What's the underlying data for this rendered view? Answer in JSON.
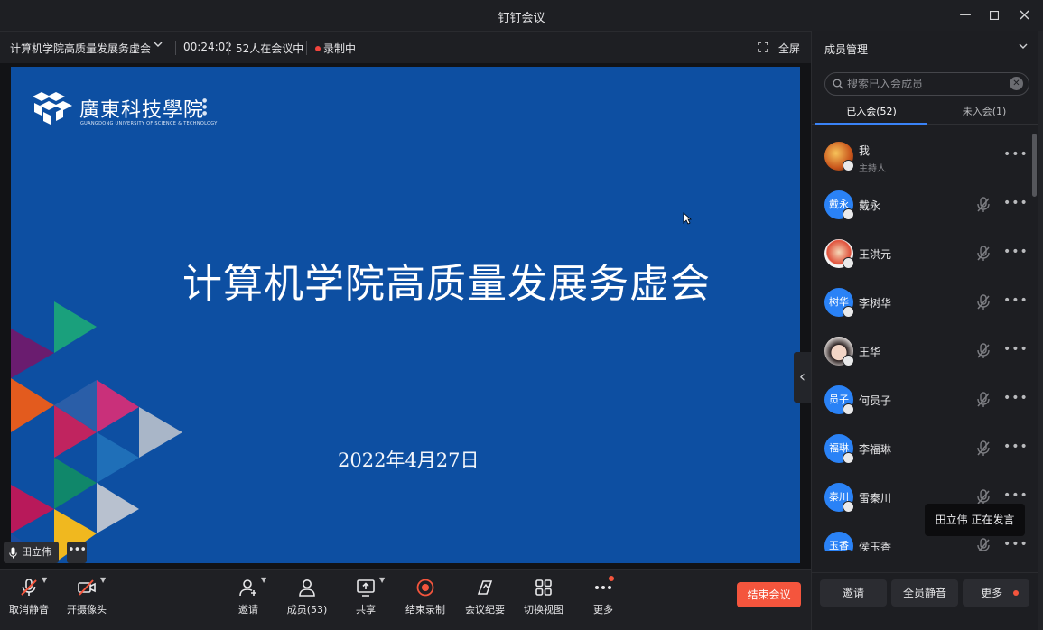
{
  "window": {
    "title": "钉钉会议"
  },
  "infobar": {
    "meeting_title": "计算机学院高质量发展务虚会",
    "duration": "00:24:02",
    "participants": "52人在会议中",
    "recording": "录制中",
    "fullscreen": "全屏"
  },
  "slide": {
    "school_name": "廣東科技學院",
    "school_name_en": "GUANGDONG UNIVERSITY OF SCIENCE & TECHNOLOGY",
    "title": "计算机学院高质量发展务虚会",
    "date": "2022年4月27日"
  },
  "speaker": {
    "name": "田立伟"
  },
  "toolbar": {
    "unmute": "取消静音",
    "camera": "开摄像头",
    "invite": "邀请",
    "members": "成员(53)",
    "share": "共享",
    "stop_record": "结束录制",
    "minutes": "会议纪要",
    "switch_view": "切换视图",
    "more": "更多",
    "end_meeting": "结束会议"
  },
  "panel": {
    "title": "成员管理",
    "search_placeholder": "搜索已入会成员",
    "tab_joined": "已入会(52)",
    "tab_not_joined": "未入会(1)",
    "members": [
      {
        "name": "我",
        "role": "主持人",
        "avatar_text": ""
      },
      {
        "name": "戴永",
        "avatar_text": "戴永"
      },
      {
        "name": "王洪元",
        "avatar_text": ""
      },
      {
        "name": "李树华",
        "avatar_text": "树华"
      },
      {
        "name": "王华",
        "avatar_text": ""
      },
      {
        "name": "何员子",
        "avatar_text": "员子"
      },
      {
        "name": "李福琳",
        "avatar_text": "福琳"
      },
      {
        "name": "雷秦川",
        "avatar_text": "秦川"
      },
      {
        "name": "侯玉香",
        "avatar_text": "玉香"
      }
    ],
    "footer": {
      "invite": "邀请",
      "mute_all": "全员静音",
      "more": "更多"
    }
  },
  "tooltip": "田立伟  正在发言",
  "colors": {
    "accent": "#3a83f7",
    "danger": "#f4553d",
    "slide_bg": "#0d4fa2"
  }
}
